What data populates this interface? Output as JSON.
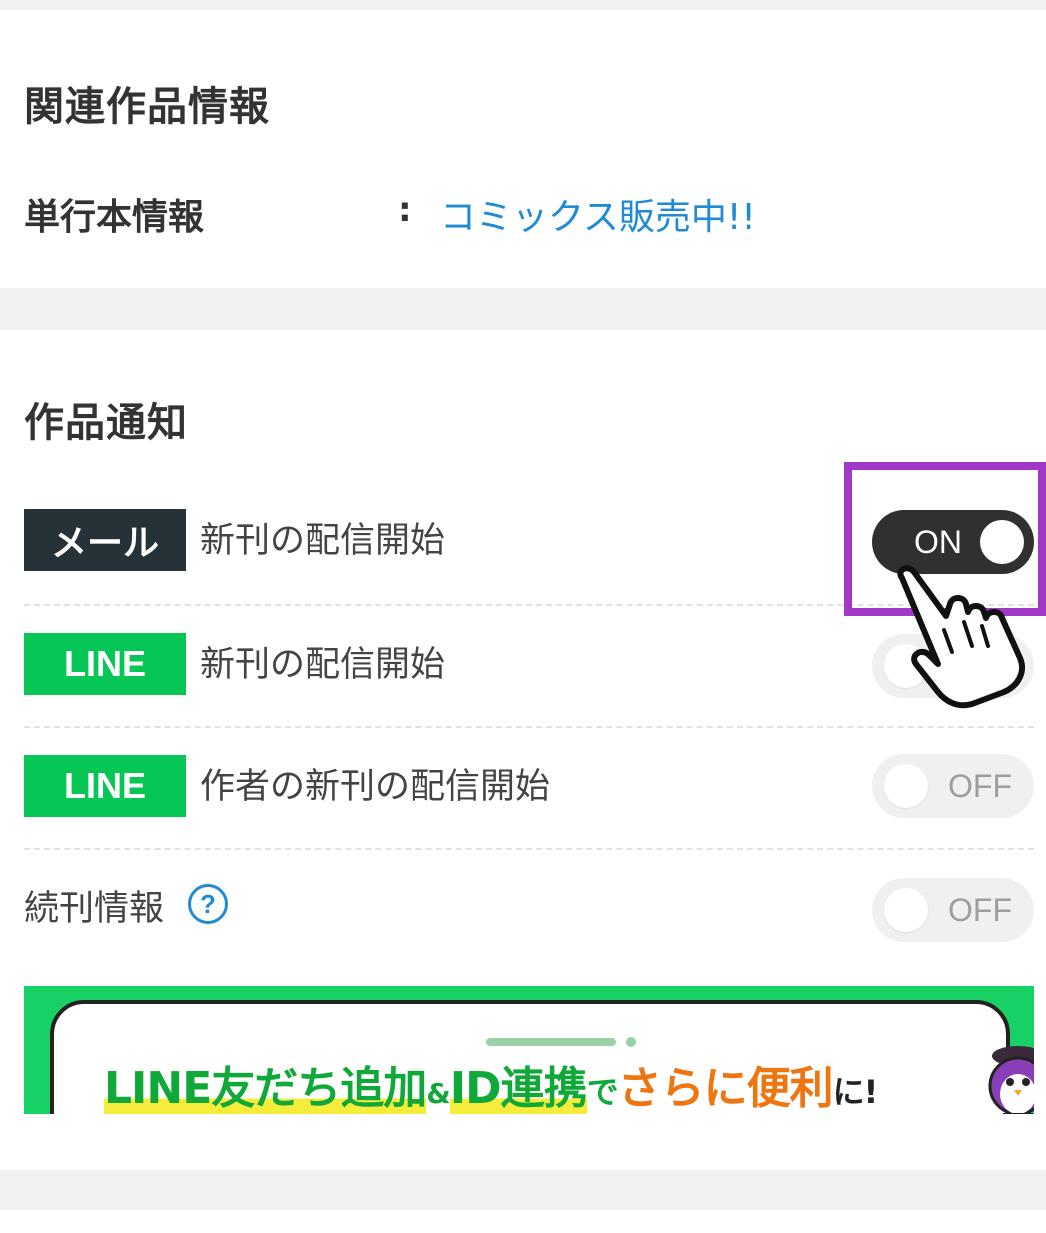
{
  "related": {
    "title": "関連作品情報",
    "book_label": "単行本情報",
    "colon": ":",
    "book_link": "コミックス販売中!!"
  },
  "notifications": {
    "title": "作品通知",
    "rows": [
      {
        "badge": "メール",
        "badge_type": "mail",
        "label": "新刊の配信開始",
        "state": "ON"
      },
      {
        "badge": "LINE",
        "badge_type": "line",
        "label": "新刊の配信開始",
        "state": "OFF"
      },
      {
        "badge": "LINE",
        "badge_type": "line",
        "label": "作者の新刊の配信開始",
        "state": "OFF"
      },
      {
        "badge": "",
        "label": "続刊情報",
        "state": "OFF",
        "help": "?"
      }
    ]
  },
  "banner": {
    "part1": "LINE友だち追加",
    "amp": "&",
    "part2": "ID連携",
    "de": "で",
    "part3": "さらに便利",
    "ni": "に!"
  },
  "colors": {
    "link": "#1f8ad6",
    "mail_badge": "#263238",
    "line_badge": "#06c755",
    "toggle_on": "#303030",
    "highlight": "#a238c8"
  }
}
